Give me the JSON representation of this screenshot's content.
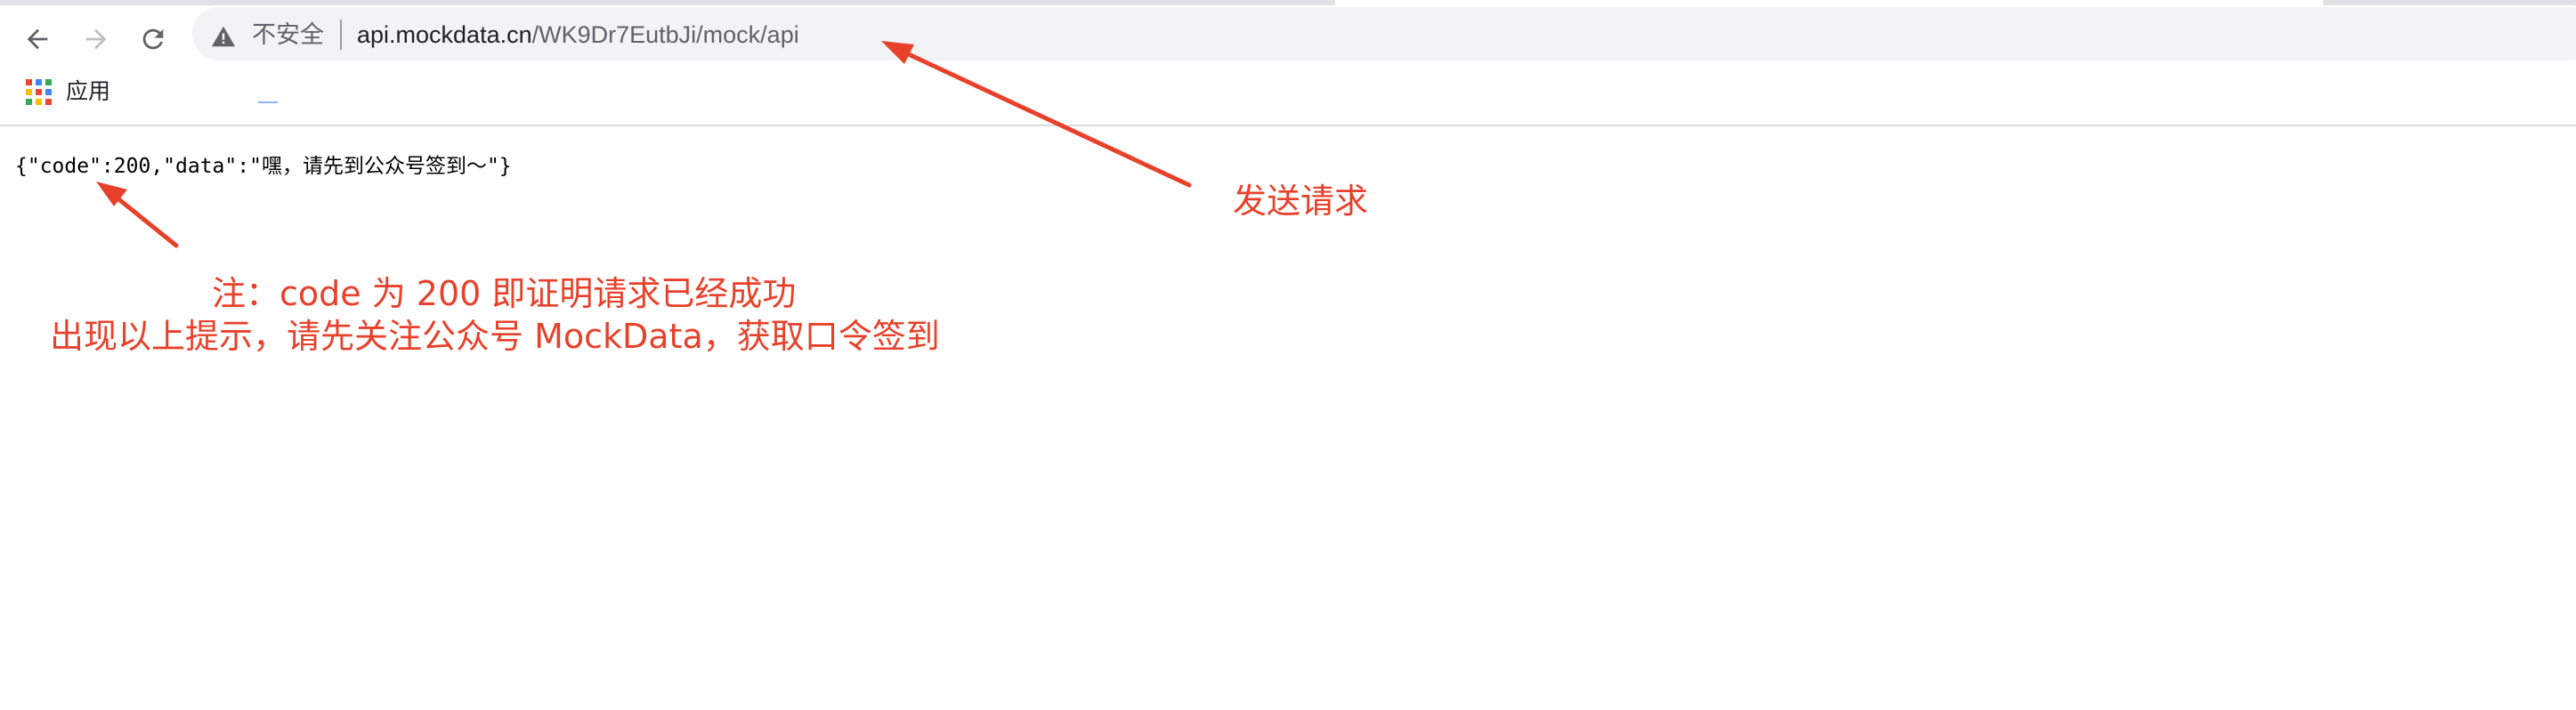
{
  "browser": {
    "nav": {
      "back_icon": "arrow-left-icon",
      "forward_icon": "arrow-right-icon",
      "reload_icon": "reload-icon"
    },
    "omnibox": {
      "security_icon": "warning-triangle-icon",
      "security_label": "不安全",
      "url_host": "api.mockdata.cn",
      "url_path": "/WK9Dr7EutbJi/mock/api"
    },
    "bookmarks": {
      "apps_icon": "apps-grid-icon",
      "apps_label": "应用"
    }
  },
  "page": {
    "json_response": "{\"code\":200,\"data\":\"嘿，请先到公众号签到～\"}"
  },
  "annotations": {
    "send_request": "发送请求",
    "note_line1": "注：code 为 200 即证明请求已经成功",
    "note_line2": "出现以上提示，请先关注公众号 MockData，获取口令签到",
    "color": "#e8412b"
  }
}
